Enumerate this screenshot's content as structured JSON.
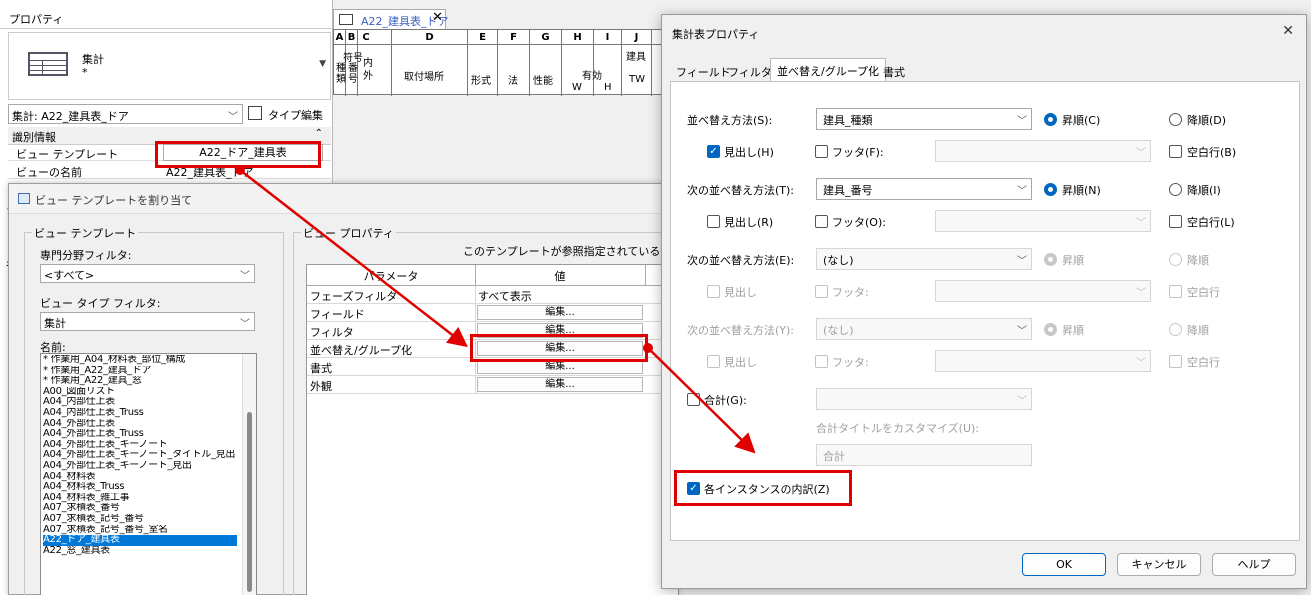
{
  "properties": {
    "title": "プロパティ",
    "type_name": "集計",
    "type_sub": "*",
    "selector_value": "集計: A22_建具表_ドア",
    "edit_type_label": "タイプ編集",
    "section_label": "識別情報",
    "rows": [
      {
        "param": "ビュー テンプレート",
        "value": "A22_ドア_建具表"
      },
      {
        "param": "ビューの名前",
        "value": "A22_建具表_ドア"
      }
    ],
    "side_letters": [
      "プ",
      "名"
    ]
  },
  "schedule": {
    "tab_label": "A22_建具表_ドア",
    "columns": [
      "A",
      "B",
      "C",
      "D",
      "E",
      "F",
      "G",
      "H",
      "I",
      "J"
    ],
    "headers": {
      "symbol": "符号",
      "kind": "種類",
      "number": "番号",
      "in_out": "内外",
      "location": "取付場所",
      "form": "形式",
      "method": "法",
      "performance": "性能",
      "effective": "有効",
      "w": "W",
      "h": "H",
      "tw": "TW",
      "fixture": "建具"
    }
  },
  "view_template_dialog": {
    "title": "ビュー テンプレートを割り当て",
    "group_label": "ビュー テンプレート",
    "discipline_label": "専門分野フィルタ:",
    "discipline_value": "<すべて>",
    "view_type_label": "ビュー タイプ フィルタ:",
    "view_type_value": "集計",
    "names_label": "名前:",
    "names": [
      "* 作業用_A04_材料表_部位_構成",
      "* 作業用_A22_建具_ドア",
      "* 作業用_A22_建具_窓",
      "A00_図面リスト",
      "A04_内部仕上表",
      "A04_内部仕上表_Truss",
      "A04_外部仕上表",
      "A04_外部仕上表_Truss",
      "A04_外部仕上表_キーノート",
      "A04_外部仕上表_キーノート_タイトル_見出",
      "A04_外部仕上表_キーノート_見出",
      "A04_材料表",
      "A04_材料表_Truss",
      "A04_材料表_雑工事",
      "A07_求積表_番号",
      "A07_求積表_記号_番号",
      "A07_求積表_記号_番号_室名",
      "A22_ドア_建具表",
      "A22_窓_建具表"
    ],
    "selected_name": "A22_ドア_建具表",
    "view_props_label": "ビュー プロパティ",
    "ref_text": "このテンプレートが参照指定されているビュー",
    "col_param": "パラメータ",
    "col_value": "値",
    "table_rows": [
      {
        "param": "フェーズフィルタ",
        "value": "すべて表示"
      },
      {
        "param": "フィールド",
        "value": "編集..."
      },
      {
        "param": "フィルタ",
        "value": "編集..."
      },
      {
        "param": "並べ替え/グループ化",
        "value": "編集..."
      },
      {
        "param": "書式",
        "value": "編集..."
      },
      {
        "param": "外観",
        "value": "編集..."
      }
    ]
  },
  "schedule_props_dialog": {
    "title": "集計表プロパティ",
    "close_label": "✕",
    "tabs": [
      "フィールド",
      "フィルタ",
      "並べ替え/グループ化",
      "書式"
    ],
    "active_tab": "並べ替え/グループ化",
    "sort1": {
      "label": "並べ替え方法(S):",
      "value": "建具_種類",
      "asc": "昇順(C)",
      "desc": "降順(D)",
      "header": "見出し(H)",
      "footer": "フッタ(F):",
      "blank": "空白行(B)"
    },
    "sort2": {
      "label": "次の並べ替え方法(T):",
      "value": "建具_番号",
      "asc": "昇順(N)",
      "desc": "降順(I)",
      "header": "見出し(R)",
      "footer": "フッタ(O):",
      "blank": "空白行(L)"
    },
    "sort3": {
      "label": "次の並べ替え方法(E):",
      "value": "(なし)",
      "asc": "昇順",
      "desc": "降順",
      "header": "見出し",
      "footer": "フッタ:",
      "blank": "空白行"
    },
    "sort4": {
      "label": "次の並べ替え方法(Y):",
      "value": "(なし)",
      "asc": "昇順",
      "desc": "降順",
      "header": "見出し",
      "footer": "フッタ:",
      "blank": "空白行"
    },
    "grand_total": "合計(G):",
    "custom_title_label": "合計タイトルをカスタマイズ(U):",
    "custom_title_value": "合計",
    "itemize": "各インスタンスの内訳(Z)",
    "ok": "OK",
    "cancel": "キャンセル",
    "help": "ヘルプ"
  },
  "colors": {
    "accent": "#0067c0",
    "highlight": "#e00000",
    "selection": "#0078d7"
  }
}
